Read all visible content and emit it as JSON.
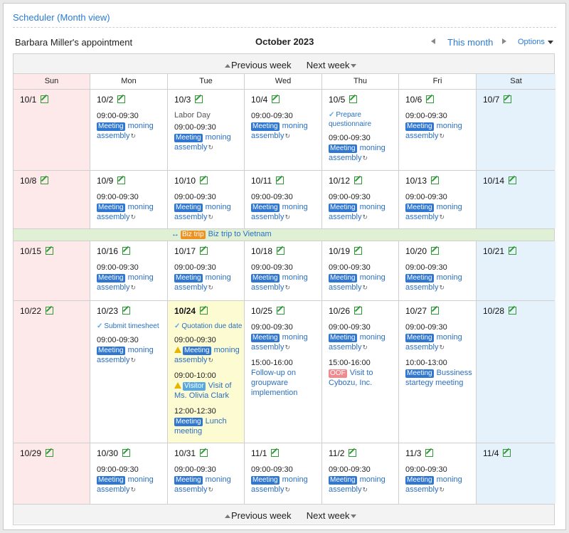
{
  "title": "Scheduler (Month view)",
  "owner": "Barbara Miller's appointment",
  "month": "October 2023",
  "this_month": "This month",
  "options": "Options",
  "nav": {
    "prev_week": "Previous week",
    "next_week": "Next week"
  },
  "days_of_week": [
    "Sun",
    "Mon",
    "Tue",
    "Wed",
    "Thu",
    "Fri",
    "Sat"
  ],
  "biz_trip": {
    "badge": "Biz trip",
    "label": "Biz trip to Vietnam"
  },
  "events": {
    "time": "09:00-09:30",
    "meeting_badge": "Meeting",
    "moning": "moning",
    "assembly": "assembly"
  },
  "weeks": [
    {
      "days": [
        "10/1",
        "10/2",
        "10/3",
        "10/4",
        "10/5",
        "10/6",
        "10/7"
      ],
      "holiday": "Labor Day",
      "todo": "Prepare questionnaire"
    },
    {
      "days": [
        "10/8",
        "10/9",
        "10/10",
        "10/11",
        "10/12",
        "10/13",
        "10/14"
      ]
    },
    {
      "days": [
        "10/15",
        "10/16",
        "10/17",
        "10/18",
        "10/19",
        "10/20",
        "10/21"
      ]
    },
    {
      "days": [
        "10/22",
        "10/23",
        "10/24",
        "10/25",
        "10/26",
        "10/27",
        "10/28"
      ],
      "todo_mon": "Submit timesheet",
      "todo_tue": "Quotation due date",
      "tue_visitor_time": "09:00-10:00",
      "tue_visitor_badge": "Visitor",
      "tue_visitor_title": "Visit of Ms. Olivia Clark",
      "tue_lunch_time": "12:00-12:30",
      "tue_lunch_title": "Lunch meeting",
      "wed_time": "15:00-16:00",
      "wed_title": "Follow-up on groupware implemention",
      "thu_time": "15:00-16:00",
      "thu_badge": "OOF",
      "thu_title": "Visit to Cybozu, Inc.",
      "fri_time": "10:00-13:00",
      "fri_title": "Bussiness startegy meeting"
    },
    {
      "days": [
        "10/29",
        "10/30",
        "10/31",
        "11/1",
        "11/2",
        "11/3",
        "11/4"
      ]
    }
  ]
}
